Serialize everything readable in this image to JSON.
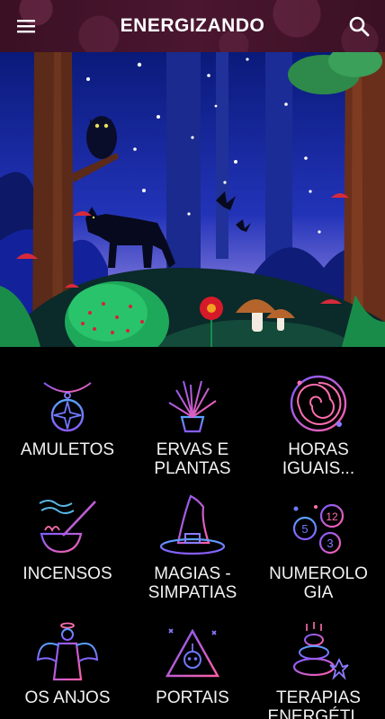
{
  "app": {
    "title": "ENERGIZANDO"
  },
  "header": {
    "menu_icon": "hamburger-menu-icon",
    "search_icon": "search-icon"
  },
  "hero": {
    "description_icon": "forest-night-illustration"
  },
  "categories": [
    {
      "label": "AMULETOS",
      "icon": "amulet-pendant-icon"
    },
    {
      "label": "ERVAS E\nPLANTAS",
      "icon": "potted-plant-icon"
    },
    {
      "label": "HORAS\nIGUAIS...",
      "icon": "spiral-clock-icon"
    },
    {
      "label": "INCENSOS",
      "icon": "incense-bowl-icon"
    },
    {
      "label": "MAGIAS -\nSIMPATIAS",
      "icon": "witch-hat-icon"
    },
    {
      "label": "NUMEROLO\nGIA",
      "icon": "numerology-coins-icon"
    },
    {
      "label": "OS ANJOS",
      "icon": "angel-icon"
    },
    {
      "label": "PORTAIS",
      "icon": "portal-triangle-icon"
    },
    {
      "label": "TERAPIAS\nENERGÉTI...",
      "icon": "zen-stones-icon"
    }
  ],
  "colors": {
    "appbar": "#3a1024",
    "icon_gradient_start": "#7d5cff",
    "icon_gradient_end": "#ff5fa8",
    "background": "#000000"
  }
}
